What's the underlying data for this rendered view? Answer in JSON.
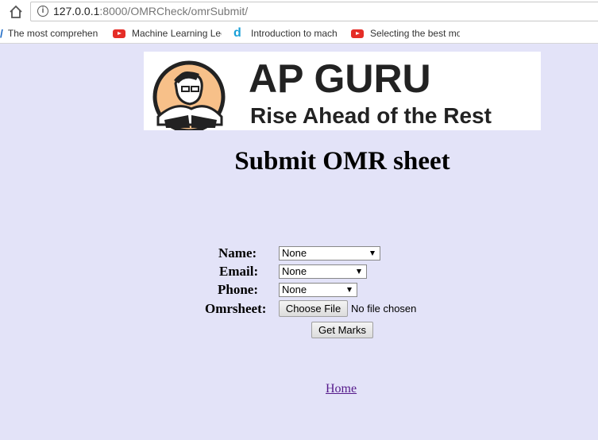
{
  "browser": {
    "url_host": "127.0.0.1",
    "url_path": ":8000/OMRCheck/omrSubmit/",
    "bookmarks": [
      {
        "label": "The most comprehen",
        "icon": "slash-icon"
      },
      {
        "label": "Machine Learning Lec",
        "icon": "youtube-icon"
      },
      {
        "label": "Introduction to mach",
        "icon": "d-icon"
      },
      {
        "label": "Selecting the best mo",
        "icon": "youtube-icon"
      }
    ]
  },
  "logo": {
    "title": "AP GURU",
    "tagline": "Rise Ahead of the Rest",
    "accent": "#f7c089"
  },
  "page": {
    "heading": "Submit OMR sheet"
  },
  "form": {
    "name_label": "Name:",
    "name_value": "None",
    "email_label": "Email:",
    "email_value": "None",
    "phone_label": "Phone:",
    "phone_value": "None",
    "omr_label": "Omrsheet:",
    "choose_file": "Choose File",
    "no_file": "No file chosen",
    "submit": "Get Marks"
  },
  "footer": {
    "home_link": "Home"
  },
  "colors": {
    "page_bg": "#e3e3f8",
    "visited_link": "#551a8b"
  }
}
